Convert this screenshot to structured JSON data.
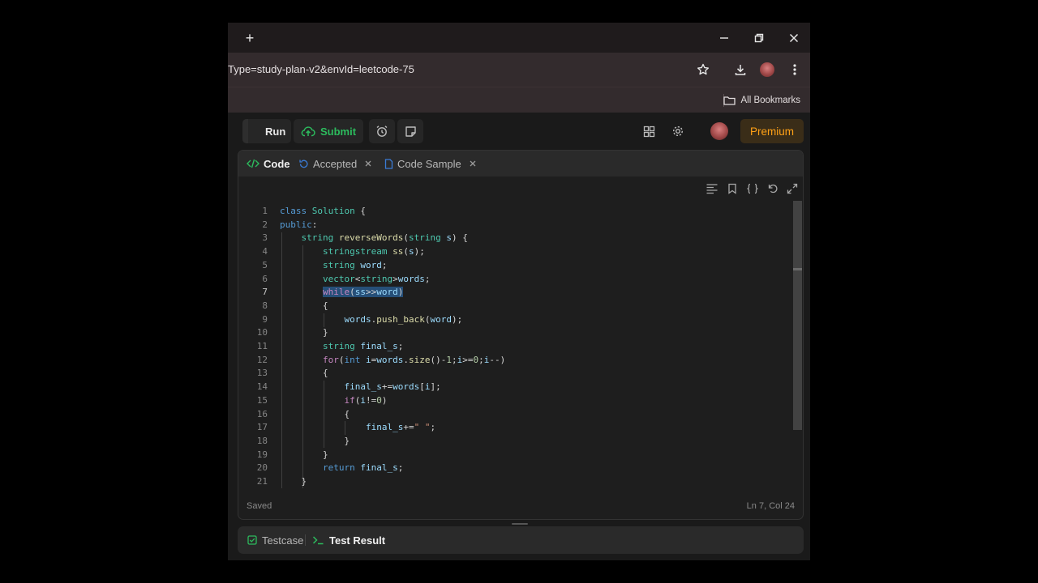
{
  "browser": {
    "new_tab": "+",
    "url": "Type=study-plan-v2&envId=leetcode-75",
    "bookmarks_label": "All Bookmarks"
  },
  "toolbar": {
    "run_label": "Run",
    "submit_label": "Submit",
    "premium_label": "Premium"
  },
  "tabs": [
    {
      "label": "Code",
      "active": true
    },
    {
      "label": "Accepted",
      "active": false
    },
    {
      "label": "Code Sample",
      "active": false
    }
  ],
  "editor": {
    "lines": [
      "class Solution {",
      "public:",
      "    string reverseWords(string s) {",
      "        stringstream ss(s);",
      "        string word;",
      "        vector<string>words;",
      "        while(ss>>word)",
      "        {",
      "            words.push_back(word);",
      "        }",
      "        string final_s;",
      "        for(int i=words.size()-1;i>=0;i--)",
      "        {",
      "            final_s+=words[i];",
      "            if(i!=0)",
      "            {",
      "                final_s+=\" \";",
      "            }",
      "        }",
      "        return final_s;",
      "    }"
    ],
    "selected_line": 7,
    "selected_text": "while(ss>>word)",
    "status_saved": "Saved",
    "cursor_position": "Ln 7, Col 24"
  },
  "bottom_tabs": [
    {
      "label": "Testcase",
      "active": false
    },
    {
      "label": "Test Result",
      "active": true
    }
  ],
  "colors": {
    "accent_green": "#2cbb5d",
    "premium_orange": "#ffa116",
    "selection": "#264f78"
  }
}
